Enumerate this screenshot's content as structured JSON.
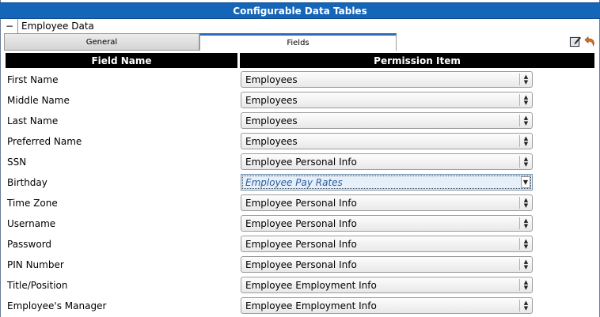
{
  "title": "Configurable Data Tables",
  "section": {
    "toggle": "−",
    "label": "Employee Data"
  },
  "tabs": {
    "general": "General",
    "fields": "Fields"
  },
  "columns": {
    "field_name": "Field Name",
    "permission_item": "Permission Item"
  },
  "rows": [
    {
      "field": "First Name",
      "permission": "Employees"
    },
    {
      "field": "Middle Name",
      "permission": "Employees"
    },
    {
      "field": "Last Name",
      "permission": "Employees"
    },
    {
      "field": "Preferred Name",
      "permission": "Employees"
    },
    {
      "field": "SSN",
      "permission": "Employee Personal Info"
    },
    {
      "field": "Birthday",
      "permission": "Employee Pay Rates",
      "focused": true
    },
    {
      "field": "Time Zone",
      "permission": "Employee Personal Info"
    },
    {
      "field": "Username",
      "permission": "Employee Personal Info"
    },
    {
      "field": "Password",
      "permission": "Employee Personal Info"
    },
    {
      "field": "PIN Number",
      "permission": "Employee Personal Info"
    },
    {
      "field": "Title/Position",
      "permission": "Employee Employment Info"
    },
    {
      "field": "Employee's Manager",
      "permission": "Employee Employment Info"
    }
  ],
  "icons": [
    "edit-icon",
    "undo-icon"
  ],
  "colors": {
    "titlebar": "#1565b8",
    "tab_accent": "#2f6db8",
    "header_bg": "#000000"
  }
}
